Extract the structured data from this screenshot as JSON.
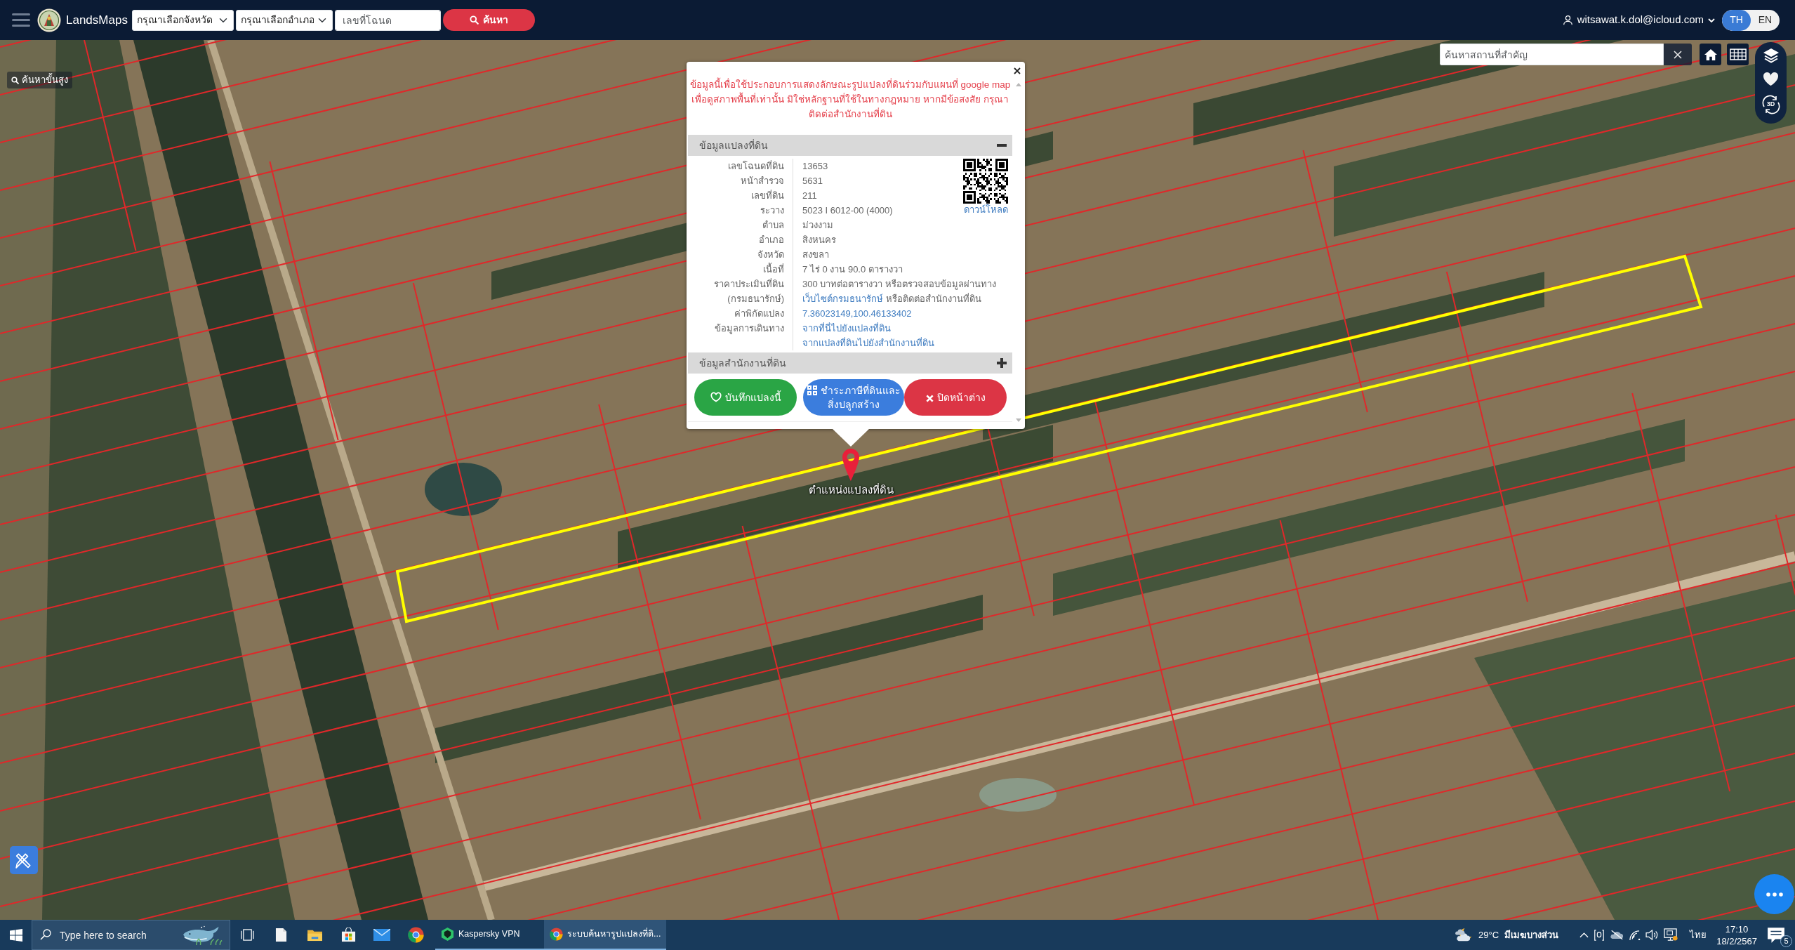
{
  "navbar": {
    "brand": "LandsMaps",
    "province_select": {
      "value": "กรุณาเลือกจังหวัด"
    },
    "district_select": {
      "value": "กรุณาเลือกอำเภอ"
    },
    "deed_field": {
      "placeholder": "เลขที่โฉนด"
    },
    "search_button": "ค้นหา",
    "user_email": "witsawat.k.dol@icloud.com",
    "languages": [
      {
        "label": "TH",
        "selected": true
      },
      {
        "label": "EN",
        "selected": false
      }
    ]
  },
  "map": {
    "advanced_search": "ค้นหาขั้นสูง",
    "place_search": {
      "placeholder": "ค้นหาสถานที่สำคัญ"
    },
    "tools": [
      {
        "kind": "layers"
      },
      {
        "kind": "favorites"
      },
      {
        "kind": "view3d",
        "label": "3D"
      }
    ],
    "popup": {
      "notice": "ข้อมูลนี้เพื่อใช้ประกอบการแสดงลักษณะรูปแปลงที่ดินร่วมกับแผนที่ google map เพื่อดูสภาพพื้นที่เท่านั้น มิใช่หลักฐานที่ใช้ในทางกฎหมาย หากมีข้อสงสัย กรุณาติดต่อสำนักงานที่ดิน",
      "sections": [
        {
          "title": "ข้อมูลแปลงที่ดิน",
          "expanded": true,
          "qr_code": {
            "link": "ดาวน์โหลด"
          },
          "rows": [
            {
              "label": "เลขโฉนดที่ดิน",
              "kind": "text",
              "value": "13653"
            },
            {
              "label": "หน้าสำรวจ",
              "kind": "text",
              "value": "5631"
            },
            {
              "label": "เลขที่ดิน",
              "kind": "text",
              "value": "211"
            },
            {
              "label": "ระวาง",
              "kind": "text",
              "value": "5023 I 6012-00 (4000)"
            },
            {
              "label": "ตำบล",
              "kind": "text",
              "value": "ม่วงงาม"
            },
            {
              "label": "อำเภอ",
              "kind": "text",
              "value": "สิงหนคร"
            },
            {
              "label": "จังหวัด",
              "kind": "text",
              "value": "สงขลา"
            },
            {
              "label": "เนื้อที่",
              "kind": "text",
              "value": "7 ไร่ 0 งาน 90.0 ตารางวา"
            },
            {
              "label": "ราคาประเมินที่ดิน (กรมธนารักษ์)",
              "kind": "mixed",
              "segments": [
                {
                  "kind": "text",
                  "text": "300 บาทต่อตารางวา หรือตรวจสอบข้อมูลผ่านทาง"
                },
                {
                  "kind": "link",
                  "text": "เว็บไซต์กรมธนารักษ์"
                },
                {
                  "kind": "text",
                  "text": "หรือติดต่อสำนักงานที่ดิน"
                }
              ]
            },
            {
              "label": "ค่าพิกัดแปลง",
              "kind": "link",
              "value": "7.36023149,100.46133402"
            },
            {
              "label": "ข้อมูลการเดินทาง",
              "kind": "links",
              "links": [
                "จากที่นี่ไปยังแปลงที่ดิน",
                "จากแปลงที่ดินไปยังสำนักงานที่ดิน"
              ]
            }
          ]
        },
        {
          "title": "ข้อมูลสำนักงานที่ดิน",
          "expanded": false
        }
      ],
      "buttons": [
        {
          "kind": "save",
          "label": "บันทึกแปลงนี้"
        },
        {
          "kind": "tax",
          "label": "ชำระภาษีที่ดินและสิ่งปลูกสร้าง"
        },
        {
          "kind": "close",
          "label": "ปิดหน้าต่าง"
        }
      ]
    },
    "marker_label": "ตำแหน่งแปลงที่ดิน"
  },
  "taskbar": {
    "search": {
      "placeholder": "Type here to search"
    },
    "windows": [
      {
        "kind": "vpn",
        "label": "Kaspersky VPN",
        "selected": false
      },
      {
        "kind": "browser",
        "label": "ระบบค้นหารูปแปลงที่ดิ...",
        "selected": true
      }
    ],
    "weather": {
      "temperature": "29°C",
      "condition": "มีเมฆบางส่วน"
    },
    "input_language": "ไทย",
    "time": "17:10",
    "date": "18/2/2567",
    "notification_count": "5"
  }
}
